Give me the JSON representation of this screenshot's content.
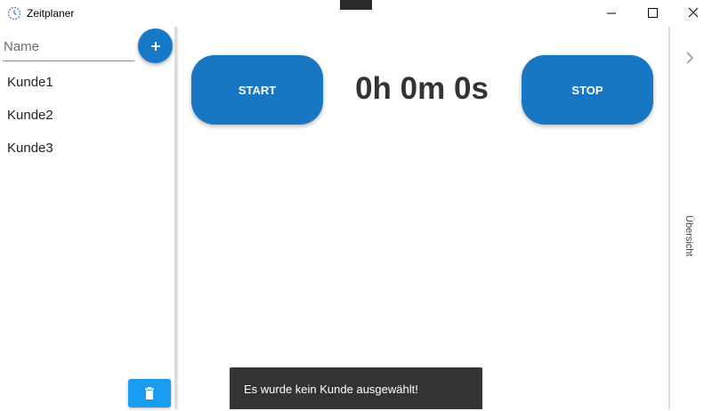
{
  "window": {
    "title": "Zeitplaner",
    "icon": "clock-app-icon",
    "controls": [
      "minimize-icon",
      "maximize-icon",
      "close-icon"
    ]
  },
  "sidebar": {
    "name_placeholder": "Name",
    "name_value": "",
    "add_icon": "plus-icon",
    "customers": [
      {
        "label": "Kunde1"
      },
      {
        "label": "Kunde2"
      },
      {
        "label": "Kunde3"
      }
    ],
    "delete_icon": "trash-icon"
  },
  "main": {
    "start_label": "START",
    "stop_label": "STOP",
    "timer": "0h 0m 0s"
  },
  "right_panel": {
    "chevron_icon": "chevron-right-icon",
    "overview_label": "Übersicht"
  },
  "snackbar": {
    "message": "Es wurde kein Kunde ausgewählt!"
  },
  "colors": {
    "primary": "#1976c2",
    "add_button": "#1878c8",
    "delete_button": "#1b9cf0",
    "snackbar_bg": "#333333",
    "timer_text": "#333333"
  }
}
